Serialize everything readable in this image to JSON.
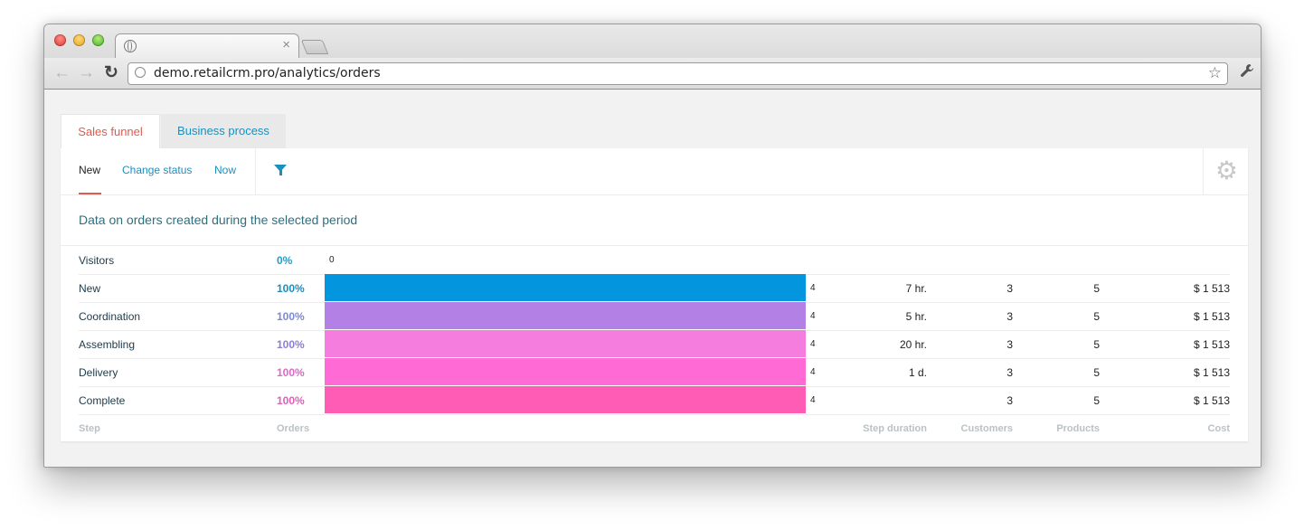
{
  "browser": {
    "tab_title": "",
    "tab_close": "×",
    "url": "demo.retailcrm.pro/analytics/orders",
    "back": "←",
    "forward": "→",
    "reload": "C",
    "star": "☆",
    "wrench": "🔧"
  },
  "page_tabs": [
    {
      "label": "Sales funnel",
      "active": true
    },
    {
      "label": "Business process",
      "active": false
    }
  ],
  "subnav": {
    "items": [
      "New",
      "Change status",
      "Now"
    ],
    "active": "New"
  },
  "description": "Data on orders created during the selected period",
  "funnel": {
    "visitors": {
      "step": "Visitors",
      "percent": "0%",
      "count": "0",
      "color": "#1b9fd0"
    },
    "rows": [
      {
        "step": "New",
        "percent": "100%",
        "count": "4",
        "duration": "7 hr.",
        "customers": "3",
        "products": "5",
        "cost": "$ 1 513",
        "color": "#0396de",
        "pct_color": "#1b8fbf",
        "fill": 1.0
      },
      {
        "step": "Coordination",
        "percent": "100%",
        "count": "4",
        "duration": "5 hr.",
        "customers": "3",
        "products": "5",
        "cost": "$ 1 513",
        "color": "#b380e6",
        "pct_color": "#7d88d8",
        "fill": 1.0
      },
      {
        "step": "Assembling",
        "percent": "100%",
        "count": "4",
        "duration": "20 hr.",
        "customers": "3",
        "products": "5",
        "cost": "$ 1 513",
        "color": "#f47ddd",
        "pct_color": "#8a7ed8",
        "fill": 1.0
      },
      {
        "step": "Delivery",
        "percent": "100%",
        "count": "4",
        "duration": "1 d.",
        "customers": "3",
        "products": "5",
        "cost": "$ 1 513",
        "color": "#ff6ad5",
        "pct_color": "#d96ac8",
        "fill": 1.0
      },
      {
        "step": "Complete",
        "percent": "100%",
        "count": "4",
        "duration": "",
        "customers": "3",
        "products": "5",
        "cost": "$ 1 513",
        "color": "#ff5cb5",
        "pct_color": "#e060b8",
        "fill": 1.0
      }
    ],
    "columns": {
      "step": "Step",
      "orders": "Orders",
      "duration": "Step duration",
      "customers": "Customers",
      "products": "Products",
      "cost": "Cost"
    }
  },
  "icons": {
    "filter": "filter-icon",
    "settings": "gear-icon"
  }
}
